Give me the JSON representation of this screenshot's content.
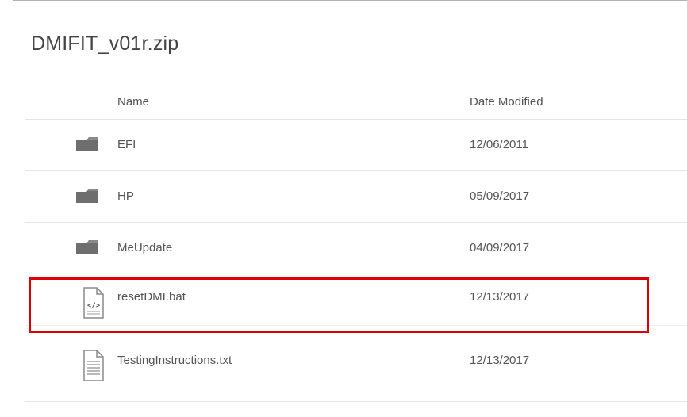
{
  "window": {
    "title": "DMIFIT_v01r.zip"
  },
  "columns": {
    "name": "Name",
    "date_modified": "Date Modified"
  },
  "files": [
    {
      "name": "EFI",
      "date": "12/06/2011",
      "type": "folder"
    },
    {
      "name": "HP",
      "date": "05/09/2017",
      "type": "folder"
    },
    {
      "name": "MeUpdate",
      "date": "04/09/2017",
      "type": "folder"
    },
    {
      "name": "resetDMI.bat",
      "date": "12/13/2017",
      "type": "script"
    },
    {
      "name": "TestingInstructions.txt",
      "date": "12/13/2017",
      "type": "text"
    }
  ],
  "highlight": {
    "target": "resetDMI.bat",
    "color": "#e00000"
  },
  "colors": {
    "folder": "#6e6e6e",
    "text": "#555555",
    "divider": "#e6e6e6"
  }
}
